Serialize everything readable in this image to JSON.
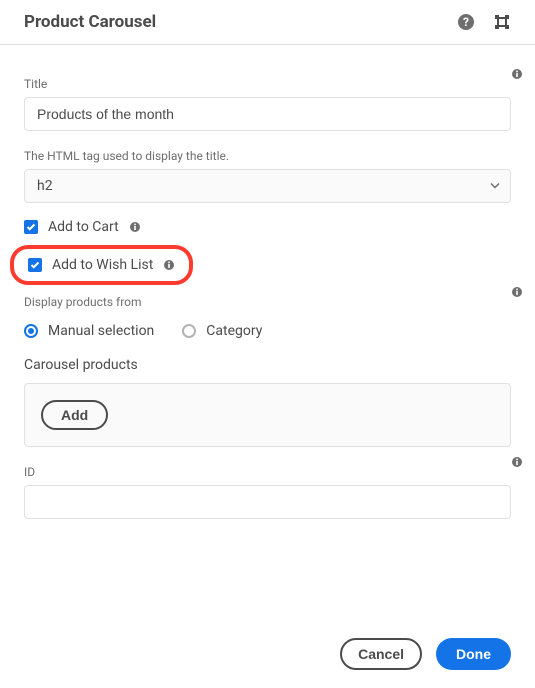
{
  "header": {
    "title": "Product Carousel"
  },
  "fields": {
    "title_label": "Title",
    "title_value": "Products of the month",
    "htmltag_label": "The HTML tag used to display the title.",
    "htmltag_value": "h2",
    "addtocart_label": "Add to Cart",
    "addtocart_checked": true,
    "addtowishlist_label": "Add to Wish List",
    "addtowishlist_checked": true,
    "displayfrom_label": "Display products from",
    "radio_manual_label": "Manual selection",
    "radio_category_label": "Category",
    "radio_selected": "manual",
    "carousel_products_label": "Carousel products",
    "add_button_label": "Add",
    "id_label": "ID",
    "id_value": ""
  },
  "buttons": {
    "cancel": "Cancel",
    "done": "Done"
  }
}
